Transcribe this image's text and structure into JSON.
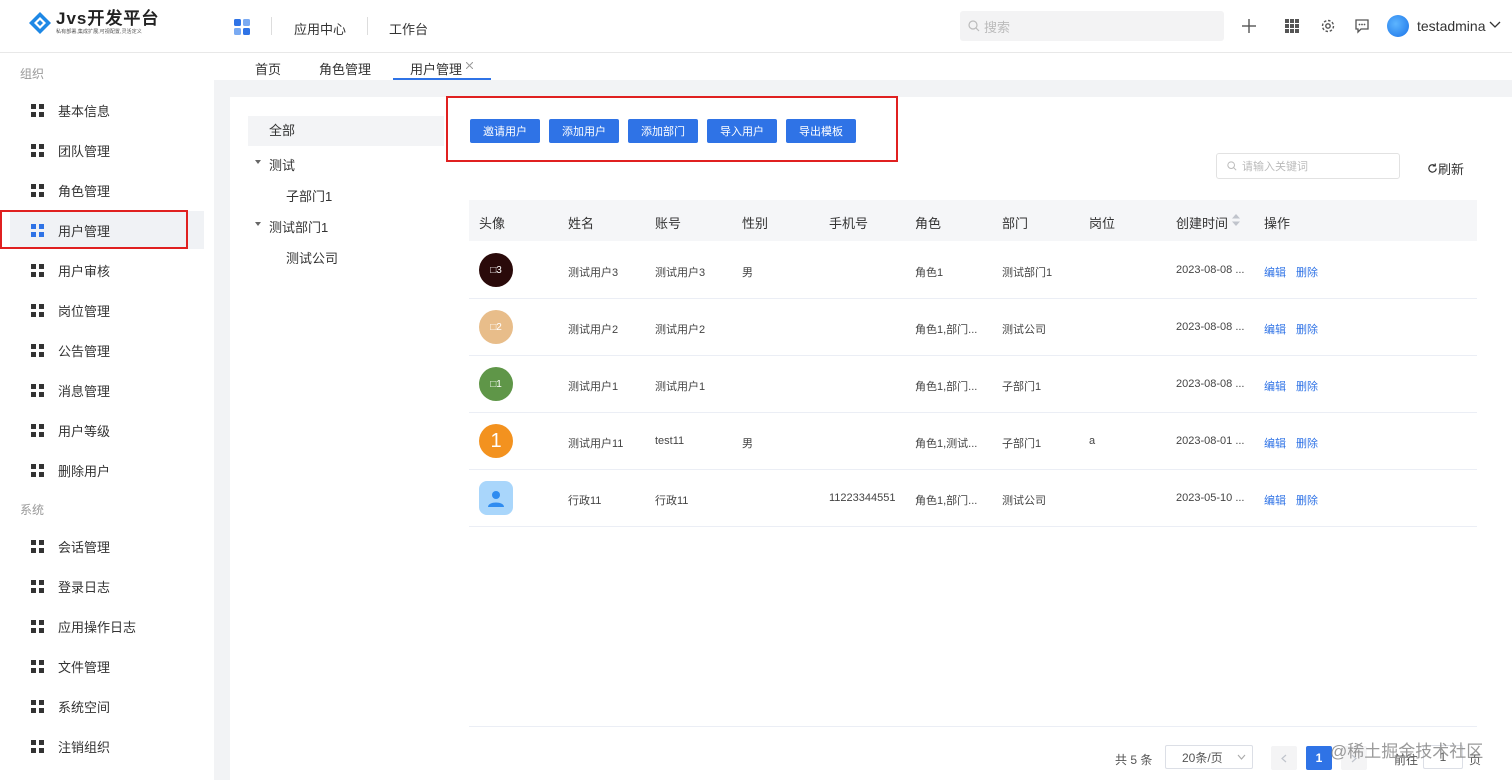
{
  "header": {
    "logo_title": "Jvs开发平台",
    "logo_subtitle": "私有部署,集成扩展,可视配置,灵活定义",
    "nav": [
      "应用中心",
      "工作台"
    ],
    "search_placeholder": "搜索",
    "username": "testadmina"
  },
  "sidebar": {
    "group_org": "组织",
    "org_items": [
      "基本信息",
      "团队管理",
      "角色管理",
      "用户管理",
      "用户审核",
      "岗位管理",
      "公告管理",
      "消息管理",
      "用户等级",
      "删除用户"
    ],
    "group_sys": "系统",
    "sys_items": [
      "会话管理",
      "登录日志",
      "应用操作日志",
      "文件管理",
      "系统空间",
      "注销组织"
    ],
    "active_item": "用户管理"
  },
  "tabs": [
    "首页",
    "角色管理",
    "用户管理"
  ],
  "active_tab": "用户管理",
  "tree": {
    "all": "全部",
    "nodes": [
      {
        "label": "测试",
        "children": [
          "子部门1"
        ]
      },
      {
        "label": "测试部门1",
        "children": [
          "测试公司"
        ]
      }
    ]
  },
  "actions": [
    "邀请用户",
    "添加用户",
    "添加部门",
    "导入用户",
    "导出模板"
  ],
  "keyword_placeholder": "请输入关键词",
  "refresh_label": "刷新",
  "table": {
    "columns": [
      "头像",
      "姓名",
      "账号",
      "性别",
      "手机号",
      "角色",
      "部门",
      "岗位",
      "创建时间",
      "操作"
    ],
    "rows": [
      {
        "avatar_text": "□3",
        "avatar_color": "#2a0a0a",
        "name": "测试用户3",
        "account": "测试用户3",
        "gender": "男",
        "phone": "",
        "role": "角色1",
        "dept": "测试部门1",
        "post": "",
        "created": "2023-08-08 ..."
      },
      {
        "avatar_text": "□2",
        "avatar_color": "#e8bd8a",
        "name": "测试用户2",
        "account": "测试用户2",
        "gender": "",
        "phone": "",
        "role": "角色1,部门...",
        "dept": "测试公司",
        "post": "",
        "created": "2023-08-08 ..."
      },
      {
        "avatar_text": "□1",
        "avatar_color": "#5f9648",
        "name": "测试用户1",
        "account": "测试用户1",
        "gender": "",
        "phone": "",
        "role": "角色1,部门...",
        "dept": "子部门1",
        "post": "",
        "created": "2023-08-08 ..."
      },
      {
        "avatar_text": "1",
        "avatar_color": "#f3921f",
        "name": "测试用户11",
        "account": "test11",
        "gender": "男",
        "phone": "",
        "role": "角色1,测试...",
        "dept": "子部门1",
        "post": "a",
        "created": "2023-08-01 ..."
      },
      {
        "avatar_text": "",
        "avatar_color": "#a9d6fb",
        "name": "行政11",
        "account": "行政11",
        "gender": "",
        "phone": "11223344551",
        "role": "角色1,部门...",
        "dept": "测试公司",
        "post": "",
        "created": "2023-05-10 ..."
      }
    ],
    "edit_label": "编辑",
    "delete_label": "删除"
  },
  "pagination": {
    "total": "共 5 条",
    "page_size": "20条/页",
    "current": "1",
    "goto_prefix": "前往",
    "goto_value": "1",
    "goto_suffix": "页"
  },
  "watermark": "@稀土掘金技术社区",
  "colors": {
    "primary": "#2f73e6",
    "highlight_box": "#e02020"
  }
}
